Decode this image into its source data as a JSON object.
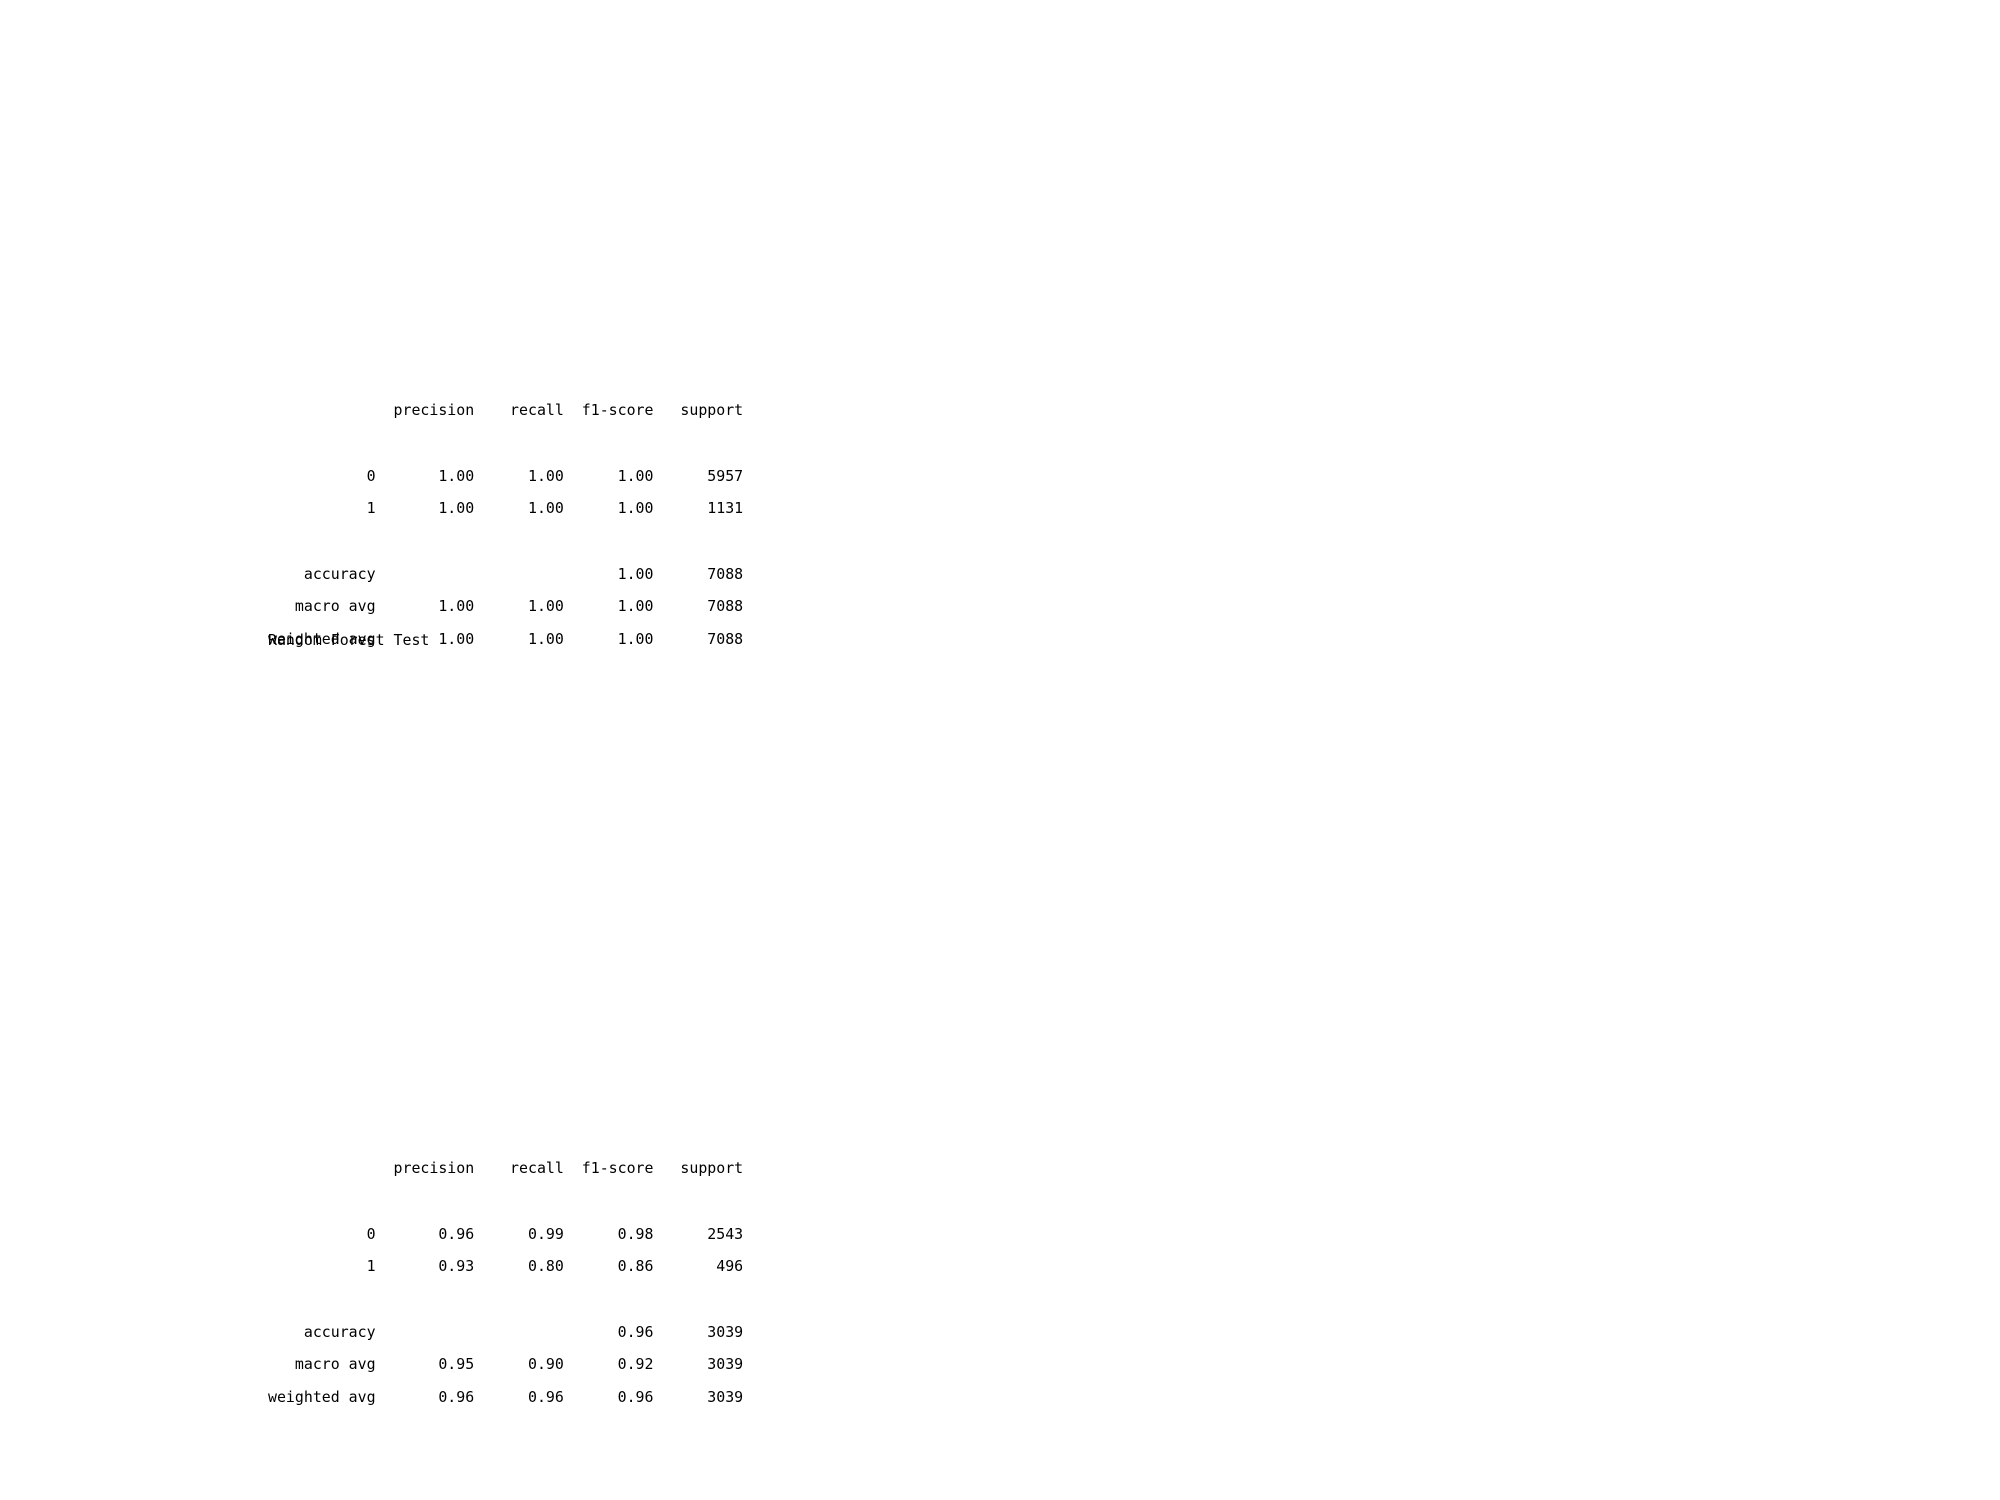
{
  "train_report": {
    "lines": [
      "              precision    recall  f1-score   support",
      "",
      "           0       1.00      1.00      1.00      5957",
      "           1       1.00      1.00      1.00      1131",
      "",
      "    accuracy                           1.00      7088",
      "   macro avg       1.00      1.00      1.00      7088",
      "weighted avg       1.00      1.00      1.00      7088"
    ]
  },
  "section_title": "Random Forest Test",
  "test_report": {
    "lines": [
      "              precision    recall  f1-score   support",
      "",
      "           0       0.96      0.99      0.98      2543",
      "           1       0.93      0.80      0.86       496",
      "",
      "    accuracy                           0.96      3039",
      "   macro avg       0.95      0.90      0.92      3039",
      "weighted avg       0.96      0.96      0.96      3039"
    ]
  }
}
